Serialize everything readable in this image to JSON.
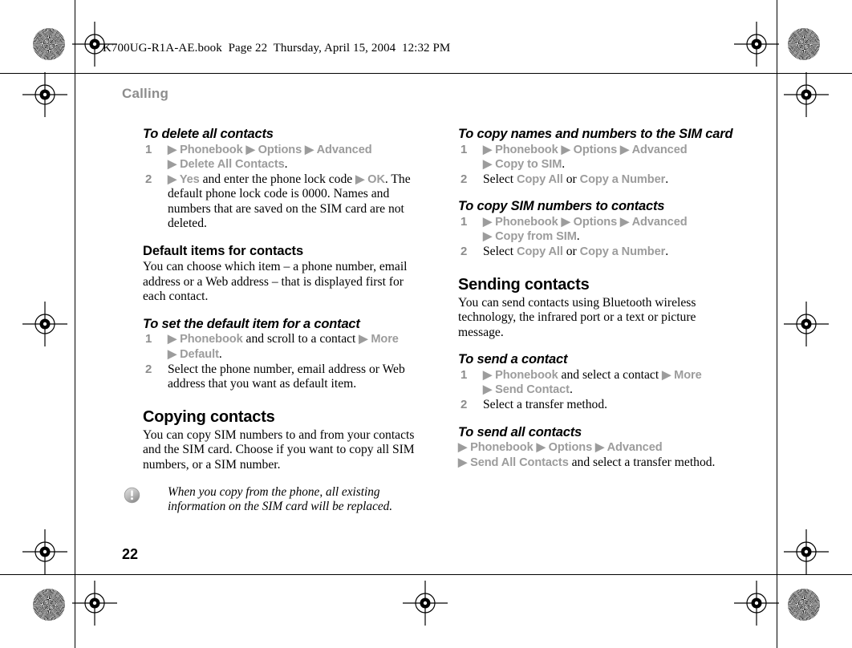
{
  "page": {
    "file_header": "K700UG-R1A-AE.book  Page 22  Thursday, April 15, 2004  12:32 PM",
    "running_head": "Calling",
    "folio": "22",
    "menu_gray": "#9c9c9c",
    "head_gray": "#8d8d8d",
    "arrow_glyph": "▶"
  },
  "left_column": {
    "proc_delete": {
      "title": "To delete all contacts",
      "steps": [
        {
          "num": "1",
          "parts": [
            {
              "type": "menu",
              "text": "▶ Phonebook ▶ Options ▶ Advanced"
            },
            {
              "type": "break"
            },
            {
              "type": "menu",
              "text": "▶ Delete All Contacts"
            },
            {
              "type": "plain",
              "text": "."
            }
          ]
        },
        {
          "num": "2",
          "parts": [
            {
              "type": "menu",
              "text": "▶ Yes"
            },
            {
              "type": "plain",
              "text": " and enter the phone lock code "
            },
            {
              "type": "menu",
              "text": "▶ OK"
            },
            {
              "type": "plain",
              "text": ". The default phone lock code is 0000. Names and numbers that are saved on the SIM card are not deleted."
            }
          ]
        }
      ]
    },
    "sub_default_items": {
      "title": "Default items for contacts",
      "body": "You can choose which item – a phone number, email address or a Web address – that is displayed first for each contact."
    },
    "proc_default_item": {
      "title": "To set the default item for a contact",
      "steps": [
        {
          "num": "1",
          "parts": [
            {
              "type": "menu",
              "text": "▶ Phonebook"
            },
            {
              "type": "plain",
              "text": " and scroll to a contact "
            },
            {
              "type": "menu",
              "text": "▶ More"
            },
            {
              "type": "break"
            },
            {
              "type": "menu",
              "text": "▶ Default"
            },
            {
              "type": "plain",
              "text": "."
            }
          ]
        },
        {
          "num": "2",
          "parts": [
            {
              "type": "plain",
              "text": "Select the phone number, email address or Web address that you want as default item."
            }
          ]
        }
      ]
    },
    "sec_copying": {
      "title": "Copying contacts",
      "body": "You can copy SIM numbers to and from your contacts and the SIM card. Choose if you want to copy all SIM numbers, or a SIM number."
    },
    "note": {
      "icon": "info-exclamation-icon",
      "text": "When you copy from the phone, all existing information on the SIM card will be replaced."
    }
  },
  "right_column": {
    "proc_copy_to_sim": {
      "title": "To copy names and numbers to the SIM card",
      "steps": [
        {
          "num": "1",
          "parts": [
            {
              "type": "menu",
              "text": "▶ Phonebook ▶ Options ▶ Advanced"
            },
            {
              "type": "break"
            },
            {
              "type": "menu",
              "text": "▶ Copy to SIM"
            },
            {
              "type": "plain",
              "text": "."
            }
          ]
        },
        {
          "num": "2",
          "parts": [
            {
              "type": "plain",
              "text": "Select "
            },
            {
              "type": "menu",
              "text": "Copy All"
            },
            {
              "type": "plain",
              "text": " or "
            },
            {
              "type": "menu",
              "text": "Copy a Number"
            },
            {
              "type": "plain",
              "text": "."
            }
          ]
        }
      ]
    },
    "proc_copy_from_sim": {
      "title": "To copy SIM numbers to contacts",
      "steps": [
        {
          "num": "1",
          "parts": [
            {
              "type": "menu",
              "text": "▶ Phonebook ▶ Options ▶ Advanced"
            },
            {
              "type": "break"
            },
            {
              "type": "menu",
              "text": "▶ Copy from SIM"
            },
            {
              "type": "plain",
              "text": "."
            }
          ]
        },
        {
          "num": "2",
          "parts": [
            {
              "type": "plain",
              "text": "Select "
            },
            {
              "type": "menu",
              "text": "Copy All"
            },
            {
              "type": "plain",
              "text": " or "
            },
            {
              "type": "menu",
              "text": "Copy a Number"
            },
            {
              "type": "plain",
              "text": "."
            }
          ]
        }
      ]
    },
    "sec_sending": {
      "title": "Sending contacts",
      "body": "You can send contacts using Bluetooth wireless technology, the infrared port or a text or picture message."
    },
    "proc_send_contact": {
      "title": "To send a contact",
      "steps": [
        {
          "num": "1",
          "parts": [
            {
              "type": "menu",
              "text": "▶ Phonebook"
            },
            {
              "type": "plain",
              "text": " and select a contact "
            },
            {
              "type": "menu",
              "text": "▶ More"
            },
            {
              "type": "break"
            },
            {
              "type": "menu",
              "text": "▶ Send Contact"
            },
            {
              "type": "plain",
              "text": "."
            }
          ]
        },
        {
          "num": "2",
          "parts": [
            {
              "type": "plain",
              "text": "Select a transfer method."
            }
          ]
        }
      ]
    },
    "proc_send_all": {
      "title": "To send all contacts",
      "steps": [
        {
          "num": "",
          "parts": [
            {
              "type": "menu",
              "text": "▶ Phonebook ▶ Options ▶ Advanced"
            },
            {
              "type": "break"
            },
            {
              "type": "menu",
              "text": "▶ Send All Contacts"
            },
            {
              "type": "plain",
              "text": " and select a transfer method."
            }
          ]
        }
      ]
    }
  },
  "print_marks": {
    "registration_targets": 8,
    "density_bursts": 4,
    "label": "registration-target"
  }
}
